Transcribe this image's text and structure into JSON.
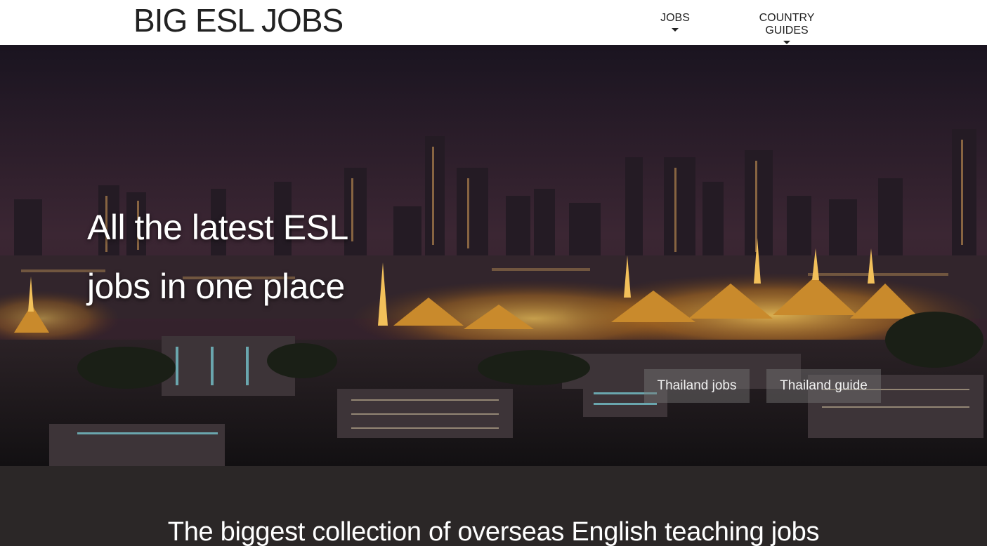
{
  "header": {
    "logo": "BIG ESL JOBS",
    "nav": [
      {
        "label": "JOBS"
      },
      {
        "label": "COUNTRY GUIDES"
      }
    ]
  },
  "hero": {
    "title_line1": "All the latest ESL",
    "title_line2": "jobs in one place",
    "buttons": [
      {
        "label": "Thailand jobs"
      },
      {
        "label": "Thailand guide"
      }
    ]
  },
  "section": {
    "title": "The biggest collection of overseas English teaching jobs"
  },
  "colors": {
    "header_bg": "#ffffff",
    "dark_section": "#2b2727",
    "city_lights": "#f2b233"
  }
}
